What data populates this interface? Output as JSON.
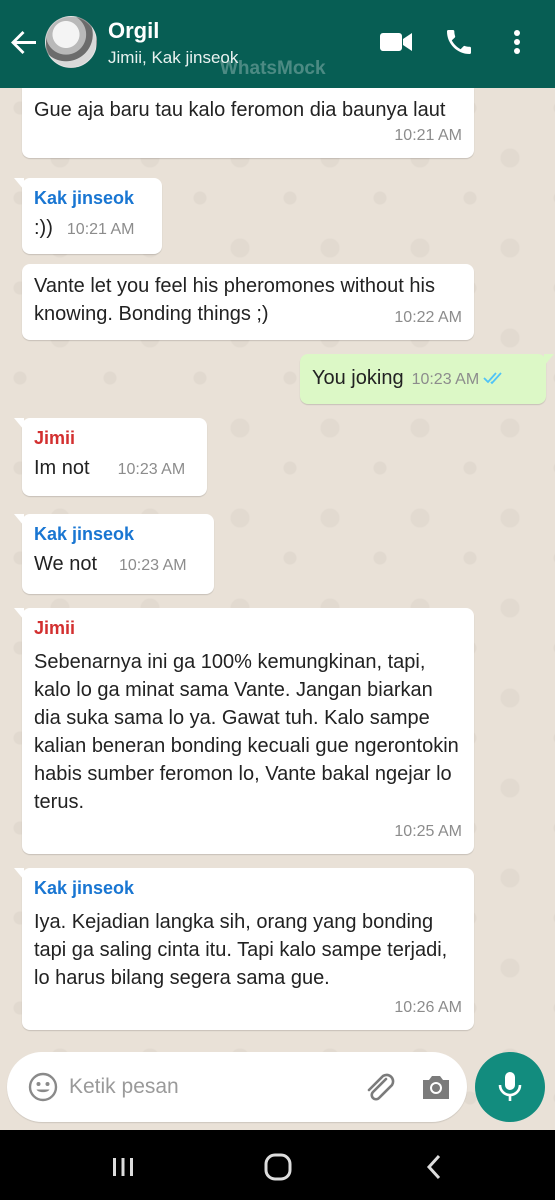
{
  "header": {
    "title": "Orgil",
    "subtitle": "Jimii, Kak jinseok",
    "watermark": "WhatsMock"
  },
  "messages": [
    {
      "direction": "in",
      "sender": "",
      "text": "Gue aja baru tau kalo feromon dia baunya laut",
      "time": "10:21 AM"
    },
    {
      "direction": "in",
      "sender": "Kak jinseok",
      "text": ":))",
      "time": "10:21 AM"
    },
    {
      "direction": "in",
      "sender": "",
      "text": "Vante let you feel his pheromones without his knowing. Bonding things ;)",
      "time": "10:22 AM"
    },
    {
      "direction": "out",
      "sender": "",
      "text": "You joking",
      "time": "10:23 AM"
    },
    {
      "direction": "in",
      "sender": "Jimii",
      "text": "Im not",
      "time": "10:23 AM"
    },
    {
      "direction": "in",
      "sender": "Kak jinseok",
      "text": "We not",
      "time": "10:23 AM"
    },
    {
      "direction": "in",
      "sender": "Jimii",
      "text": "Sebenarnya ini ga 100% kemungkinan, tapi, kalo lo ga minat sama Vante. Jangan biarkan dia suka sama lo ya. Gawat tuh. Kalo sampe kalian beneran bonding kecuali gue ngerontokin habis sumber feromon lo, Vante bakal ngejar lo terus.",
      "time": "10:25 AM"
    },
    {
      "direction": "in",
      "sender": "Kak jinseok",
      "text": "Iya. Kejadian langka sih, orang yang bonding tapi ga saling cinta itu. Tapi kalo sampe terjadi, lo harus bilang segera sama gue.",
      "time": "10:26 AM"
    }
  ],
  "colors": {
    "header": "#075e54",
    "outgoing_bubble": "#dcf8c6",
    "sender_jimii": "#d32f2f",
    "sender_jinseok": "#1976d2",
    "read_ticks": "#4fc3f7",
    "mic_button": "#128c7e"
  },
  "input": {
    "placeholder": "Ketik pesan",
    "value": ""
  },
  "icons": {
    "back": "arrow-left-icon",
    "video": "video-camera-icon",
    "call": "phone-icon",
    "more": "more-vertical-icon",
    "emoji": "smiley-icon",
    "attach": "paperclip-icon",
    "camera": "camera-icon",
    "mic": "microphone-icon",
    "nav_recent": "recent-apps-icon",
    "nav_home": "home-icon",
    "nav_back": "nav-back-icon"
  }
}
